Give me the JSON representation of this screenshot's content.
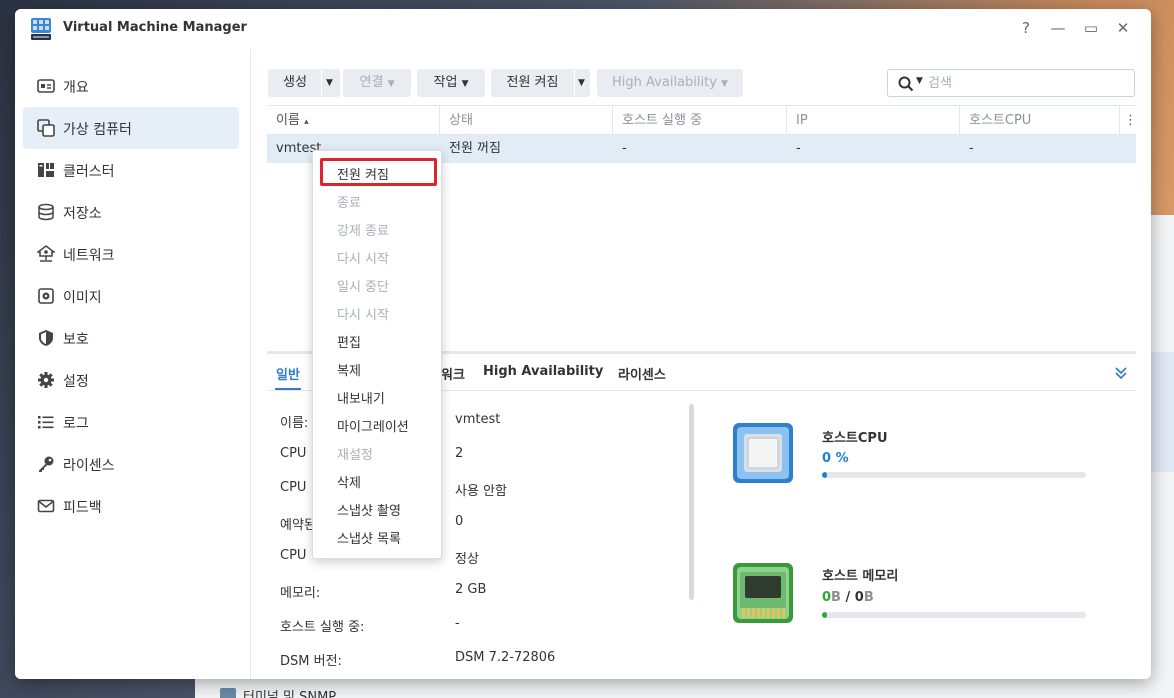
{
  "window": {
    "title": "Virtual Machine Manager"
  },
  "titlebar": {
    "help": "?",
    "minimize": "—",
    "maximize": "▭",
    "close": "✕"
  },
  "sidebar": {
    "items": [
      {
        "label": "개요",
        "icon": "overview-icon",
        "active": false
      },
      {
        "label": "가상 컴퓨터",
        "icon": "virtual-machine-icon",
        "active": true
      },
      {
        "label": "클러스터",
        "icon": "cluster-icon",
        "active": false
      },
      {
        "label": "저장소",
        "icon": "storage-icon",
        "active": false
      },
      {
        "label": "네트워크",
        "icon": "network-icon",
        "active": false
      },
      {
        "label": "이미지",
        "icon": "image-icon",
        "active": false
      },
      {
        "label": "보호",
        "icon": "shield-icon",
        "active": false
      },
      {
        "label": "설정",
        "icon": "gear-icon",
        "active": false
      },
      {
        "label": "로그",
        "icon": "log-icon",
        "active": false
      },
      {
        "label": "라이센스",
        "icon": "key-icon",
        "active": false
      },
      {
        "label": "피드백",
        "icon": "mail-icon",
        "active": false
      }
    ]
  },
  "toolbar": {
    "create": "생성",
    "connect": "연결",
    "action": "작업",
    "power_on": "전원 켜짐",
    "high_availability": "High Availability"
  },
  "search": {
    "placeholder": "검색"
  },
  "grid": {
    "columns": [
      "이름",
      "상태",
      "호스트 실행 중",
      "IP",
      "호스트CPU"
    ],
    "sort_indicator": "▴",
    "rows": [
      [
        "vmtest",
        "전원 꺼짐",
        "-",
        "-",
        "-"
      ]
    ]
  },
  "context_menu": {
    "items": [
      {
        "label": "전원 켜짐",
        "enabled": true,
        "highlighted": true
      },
      {
        "label": "종료",
        "enabled": false
      },
      {
        "label": "강제 종료",
        "enabled": false
      },
      {
        "label": "다시 시작",
        "enabled": false
      },
      {
        "label": "일시 중단",
        "enabled": false
      },
      {
        "label": "다시 시작",
        "enabled": false
      },
      {
        "label": "편집",
        "enabled": true
      },
      {
        "label": "복제",
        "enabled": true
      },
      {
        "label": "내보내기",
        "enabled": true
      },
      {
        "label": "마이그레이션",
        "enabled": true
      },
      {
        "label": "재설정",
        "enabled": false
      },
      {
        "label": "삭제",
        "enabled": true
      },
      {
        "label": "스냅샷 촬영",
        "enabled": true
      },
      {
        "label": "스냅샷 목록",
        "enabled": true
      }
    ]
  },
  "detail": {
    "tabs": [
      "일반",
      "워크",
      "High Availability",
      "라이센스"
    ],
    "rows": [
      {
        "label": "이름:",
        "value": "vmtest"
      },
      {
        "label": "CPU",
        "value": "2"
      },
      {
        "label": "CPU",
        "value": "사용 안함"
      },
      {
        "label": "예약된",
        "value": "0"
      },
      {
        "label": "CPU",
        "value": "정상"
      },
      {
        "label": "메모리:",
        "value": "2 GB"
      },
      {
        "label": "호스트 실행 중:",
        "value": "-"
      },
      {
        "label": "DSM 버전:",
        "value": "DSM 7.2-72806"
      }
    ],
    "host_cpu": {
      "title": "호스트CPU",
      "value": "0",
      "unit": "%",
      "percent": 2,
      "color": "#1f7fd6"
    },
    "host_memory": {
      "title": "호스트 메모리",
      "used": "0",
      "used_unit": "B",
      "sep": " / ",
      "total": "0",
      "total_unit": "B",
      "percent": 2,
      "color": "#2ea82e"
    }
  },
  "desktop": {
    "bottom_item": "터미널 및 SNMP"
  }
}
